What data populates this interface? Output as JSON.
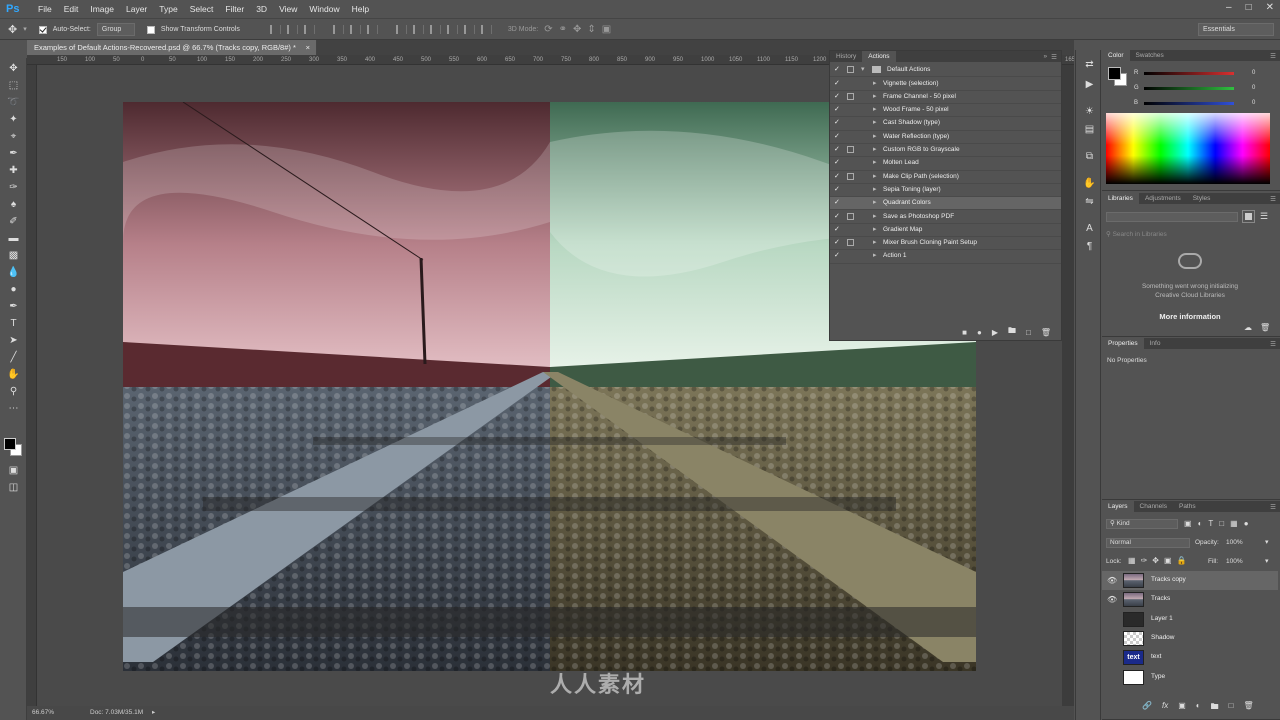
{
  "app": {
    "logo": "Ps"
  },
  "menu": [
    "File",
    "Edit",
    "Image",
    "Layer",
    "Type",
    "Select",
    "Filter",
    "3D",
    "View",
    "Window",
    "Help"
  ],
  "options": {
    "auto_select_label": "Auto-Select:",
    "group_value": "Group",
    "transform_label": "Show Transform Controls",
    "mode_3d_label": "3D Mode:",
    "workspace": "Essentials"
  },
  "document": {
    "tab_title": "Examples of Default Actions-Recovered.psd @ 66.7% (Tracks copy, RGB/8#) *",
    "zoom": "66.67%",
    "doc_size": "Doc: 7.03M/35.1M"
  },
  "ruler": {
    "ticks": [
      "150",
      "100",
      "50",
      "0",
      "50",
      "100",
      "150",
      "200",
      "250",
      "300",
      "350",
      "400",
      "450",
      "500",
      "550",
      "600",
      "650",
      "700",
      "750",
      "800",
      "850",
      "900",
      "950",
      "1000",
      "1050",
      "1100",
      "1150",
      "1200",
      "1250",
      "1300",
      "1350",
      "1400",
      "1450",
      "1500",
      "1550",
      "1600",
      "1650"
    ]
  },
  "history_actions": {
    "tabs": [
      "History",
      "Actions"
    ],
    "set_name": "Default Actions",
    "items": [
      {
        "label": "Vignette (selection)",
        "dialog": false
      },
      {
        "label": "Frame Channel - 50 pixel",
        "dialog": true
      },
      {
        "label": "Wood Frame - 50 pixel",
        "dialog": false
      },
      {
        "label": "Cast Shadow (type)",
        "dialog": false
      },
      {
        "label": "Water Reflection (type)",
        "dialog": false
      },
      {
        "label": "Custom RGB to Grayscale",
        "dialog": true
      },
      {
        "label": "Molten Lead",
        "dialog": false
      },
      {
        "label": "Make Clip Path (selection)",
        "dialog": true
      },
      {
        "label": "Sepia Toning (layer)",
        "dialog": false
      },
      {
        "label": "Quadrant Colors",
        "dialog": false,
        "selected": true
      },
      {
        "label": "Save as Photoshop PDF",
        "dialog": true
      },
      {
        "label": "Gradient Map",
        "dialog": false
      },
      {
        "label": "Mixer Brush Cloning Paint Setup",
        "dialog": true
      },
      {
        "label": "Action 1",
        "dialog": false
      }
    ]
  },
  "color_panel": {
    "tabs": [
      "Color",
      "Swatches"
    ],
    "sliders": [
      {
        "channel": "R",
        "value": "0",
        "color": "#d83030"
      },
      {
        "channel": "G",
        "value": "0",
        "color": "#30c040"
      },
      {
        "channel": "B",
        "value": "0",
        "color": "#3050d8"
      }
    ]
  },
  "libraries": {
    "tabs": [
      "Libraries",
      "Adjustments",
      "Styles"
    ],
    "search_placeholder": "Search in Libraries",
    "error": "Something went wrong initializing Creative Cloud Libraries",
    "more_info": "More information"
  },
  "properties": {
    "tabs": [
      "Properties",
      "Info"
    ],
    "empty": "No Properties"
  },
  "layers_panel": {
    "tabs": [
      "Layers",
      "Channels",
      "Paths"
    ],
    "kind": "Kind",
    "blend": "Normal",
    "opacity_label": "Opacity:",
    "opacity": "100%",
    "lock_label": "Lock:",
    "fill_label": "Fill:",
    "fill": "100%",
    "layers": [
      {
        "name": "Tracks copy",
        "visible": true,
        "selected": true,
        "thumb": "photo"
      },
      {
        "name": "Tracks",
        "visible": true,
        "selected": false,
        "thumb": "photo"
      },
      {
        "name": "Layer 1",
        "visible": false,
        "selected": false,
        "thumb": "dark"
      },
      {
        "name": "Shadow",
        "visible": false,
        "selected": false,
        "thumb": "checker"
      },
      {
        "name": "text",
        "visible": false,
        "selected": false,
        "thumb": "text",
        "thumb_label": "text"
      },
      {
        "name": "Type",
        "visible": false,
        "selected": false,
        "thumb": "white"
      }
    ]
  },
  "colors": {
    "accent": "#31a8ff",
    "bg": "#535353",
    "panel_dark": "#3f3f3f"
  }
}
